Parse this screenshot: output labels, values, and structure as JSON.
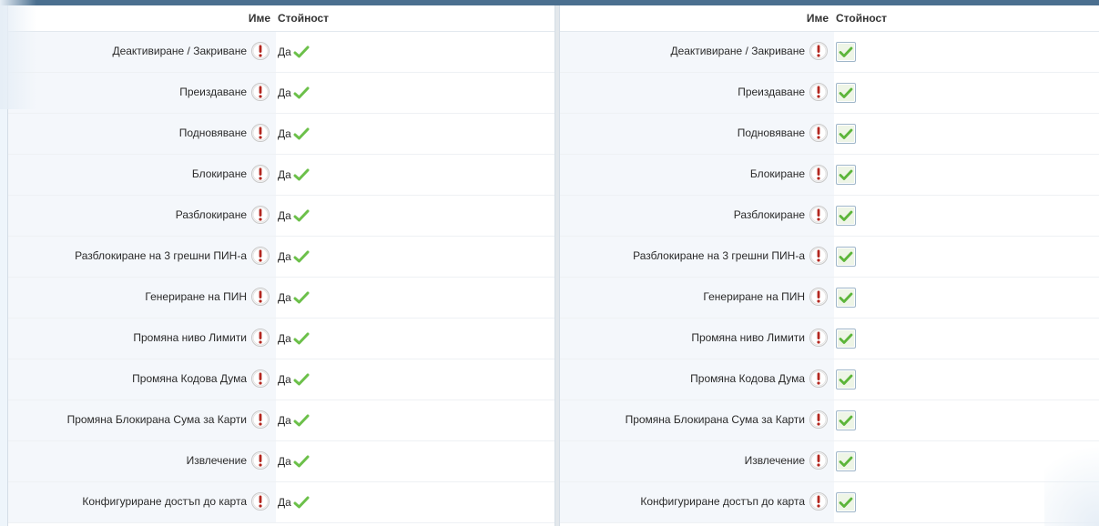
{
  "left": {
    "header": {
      "name": "Име",
      "value": "Стойност"
    },
    "yes_text": "Да",
    "rows": [
      {
        "label": "Деактивиране / Закриване"
      },
      {
        "label": "Преиздаване"
      },
      {
        "label": "Подновяване"
      },
      {
        "label": "Блокиране"
      },
      {
        "label": "Разблокиране"
      },
      {
        "label": "Разблокиране на 3 грешни ПИН-а"
      },
      {
        "label": "Генериране на ПИН"
      },
      {
        "label": "Промяна ниво Лимити"
      },
      {
        "label": "Промяна Кодова Дума"
      },
      {
        "label": "Промяна Блокирана Сума за Карти"
      },
      {
        "label": "Извлечение"
      },
      {
        "label": "Конфигуриране достъп до карта"
      }
    ]
  },
  "right": {
    "header": {
      "name": "Име",
      "value": "Стойност"
    },
    "rows": [
      {
        "label": "Деактивиране / Закриване",
        "checked": true
      },
      {
        "label": "Преиздаване",
        "checked": true
      },
      {
        "label": "Подновяване",
        "checked": true
      },
      {
        "label": "Блокиране",
        "checked": true
      },
      {
        "label": "Разблокиране",
        "checked": true
      },
      {
        "label": "Разблокиране на 3 грешни ПИН-а",
        "checked": true
      },
      {
        "label": "Генериране на ПИН",
        "checked": true
      },
      {
        "label": "Промяна ниво Лимити",
        "checked": true
      },
      {
        "label": "Промяна Кодова Дума",
        "checked": true
      },
      {
        "label": "Промяна Блокирана Сума за Карти",
        "checked": true
      },
      {
        "label": "Извлечение",
        "checked": true
      },
      {
        "label": "Конфигуриране достъп до карта",
        "checked": true
      }
    ]
  },
  "icons": {
    "info": "warning-icon",
    "yes": "checkmark-icon"
  },
  "colors": {
    "header_bar": "#4b6f8f",
    "check_green": "#6cc04a",
    "warn_red": "#b3261e"
  }
}
